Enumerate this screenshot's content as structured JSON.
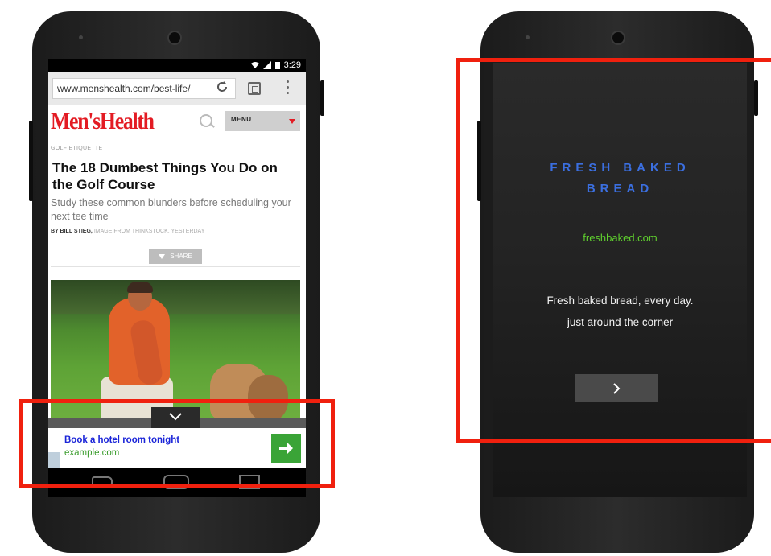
{
  "left_phone": {
    "status_bar": {
      "time": "3:29"
    },
    "browser": {
      "url": "www.menshealth.com/best-life/"
    },
    "site": {
      "logo_text": "Men'sHealth",
      "menu_label": "MENU",
      "category": "GOLF ETIQUETTE",
      "headline": "The 18 Dumbest Things You Do on the Golf Course",
      "dek": "Study these common blunders before scheduling your next tee time",
      "byline_author": "BY BILL STIEG,",
      "byline_rest": " IMAGE FROM THINKSTOCK, YESTERDAY",
      "share_label": "SHARE"
    },
    "banner_ad": {
      "title": "Book a hotel room tonight",
      "url": "example.com"
    }
  },
  "right_phone": {
    "interstitial_ad": {
      "headline_line1": "FRESH BAKED",
      "headline_line2": "BREAD",
      "url": "freshbaked.com",
      "body_line1": "Fresh baked bread, every day.",
      "body_line2": "just around the corner"
    }
  },
  "colors": {
    "highlight_box": "#f0200e",
    "logo_red": "#e31b23",
    "ad_title_blue": "#1a24d8",
    "ad_url_green": "#3a9c2c",
    "cta_green": "#3aa437",
    "interstitial_headline_blue": "#3b6fe0",
    "interstitial_url_green": "#5fcf2e"
  },
  "icons": [
    "reload-icon",
    "tabs-icon",
    "more-icon",
    "search-icon",
    "chevron-down-icon",
    "arrow-right-icon",
    "back-icon",
    "home-icon",
    "recents-icon",
    "chevron-right-icon"
  ]
}
